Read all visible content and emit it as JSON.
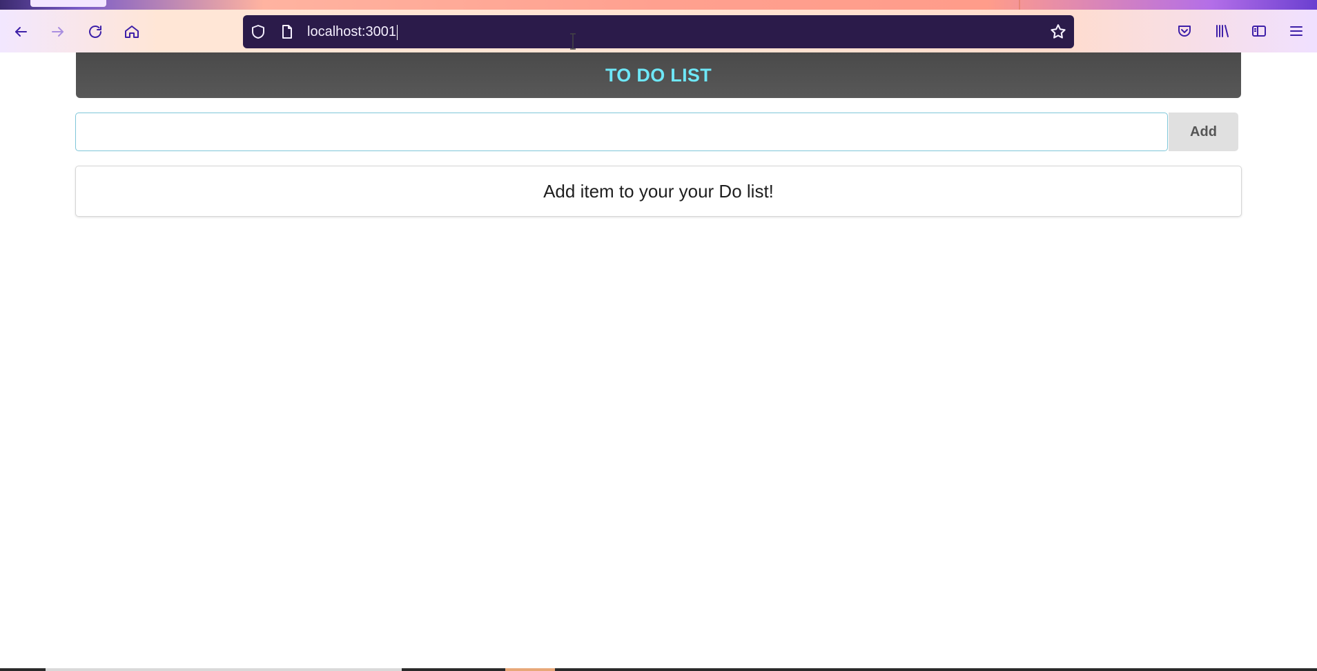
{
  "browser": {
    "url": "localhost:3001",
    "icons": {
      "back": "back-arrow-icon",
      "forward": "forward-arrow-icon",
      "reload": "reload-icon",
      "home": "home-icon",
      "shield": "shield-icon",
      "page": "page-icon",
      "star": "bookmark-star-icon",
      "pocket": "pocket-icon",
      "library": "library-icon",
      "sidebar": "sidebar-icon",
      "menu": "hamburger-menu-icon"
    },
    "colors": {
      "url_bar_bg": "#2b1b4a",
      "icon_color": "#3d1fa8"
    }
  },
  "app": {
    "header_title": "TO DO LIST",
    "input_value": "",
    "add_button_label": "Add",
    "empty_message": "Add item to your your Do list!",
    "colors": {
      "header_bg": "#4f4f4f",
      "header_text": "#6ee7f7",
      "add_button_bg": "#e0e0e0"
    }
  }
}
